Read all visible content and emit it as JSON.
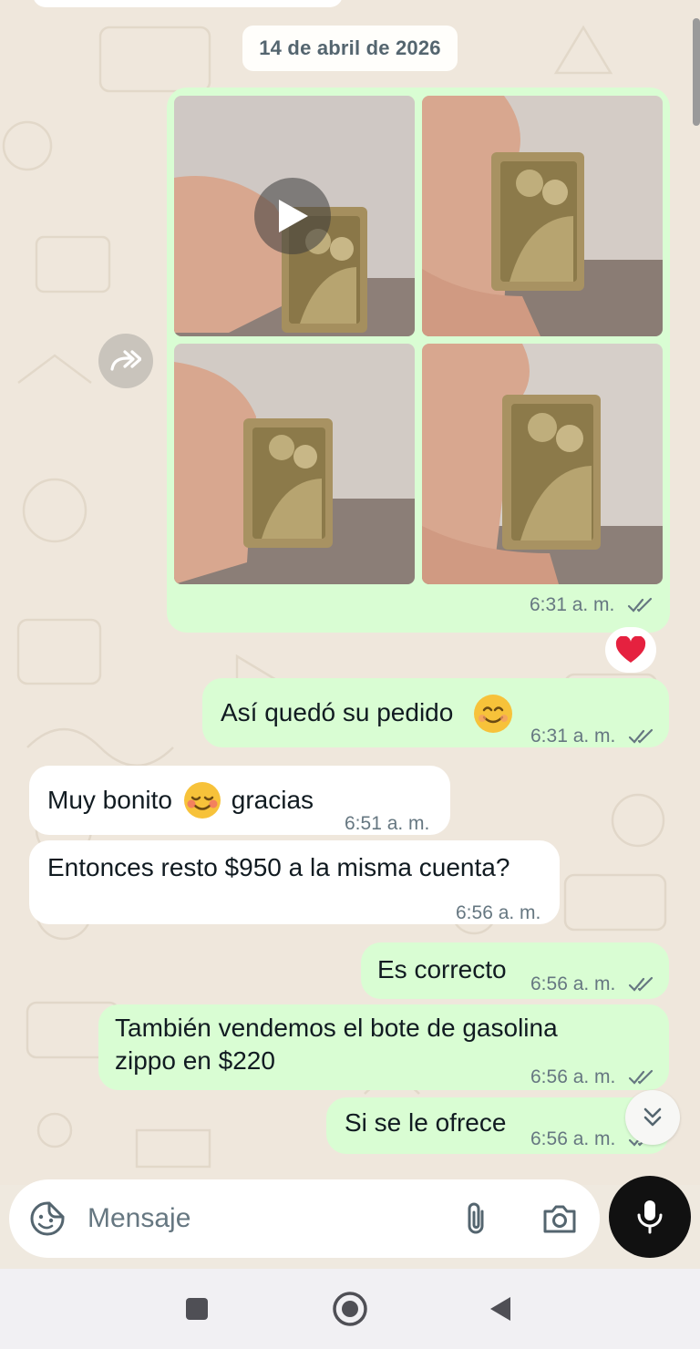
{
  "colors": {
    "wallpaper": "#efe7dc",
    "outgoing_bubble": "#d9fdd3",
    "incoming_bubble": "#ffffff",
    "timestamp": "#667781",
    "tick": "#667781",
    "mic_button": "#111111",
    "heart": "#e5213f"
  },
  "chat": {
    "date_divider": "14 de abril de 2026",
    "media_message": {
      "time": "6:31 a. m.",
      "status": "read",
      "items": [
        "video",
        "photo",
        "photo",
        "photo"
      ],
      "reaction": "heart-emoji"
    },
    "messages": [
      {
        "direction": "out",
        "text": "Así quedó su pedido",
        "emoji": "smiling-face-emoji",
        "time": "6:31 a. m.",
        "status": "read"
      },
      {
        "direction": "in",
        "text_before": "Muy bonito",
        "emoji": "blushing-face-emoji",
        "text_after": " gracias",
        "time": "6:51 a. m."
      },
      {
        "direction": "in",
        "text": "Entonces resto $950 a la misma cuenta?",
        "time": "6:56 a. m."
      },
      {
        "direction": "out",
        "text": "Es correcto",
        "time": "6:56 a. m.",
        "status": "read"
      },
      {
        "direction": "out",
        "text_line1": "También vendemos el bote de gasolina",
        "text_line2": "zippo en $220",
        "time": "6:56 a. m.",
        "status": "read"
      },
      {
        "direction": "out",
        "text": "Si se le ofrece",
        "time": "6:56 a. m.",
        "status": "read"
      }
    ]
  },
  "composer": {
    "placeholder": "Mensaje",
    "icons": [
      "sticker-icon",
      "attach-icon",
      "camera-icon",
      "mic-icon"
    ]
  },
  "navbar": {
    "icons": [
      "recents-icon",
      "home-icon",
      "back-icon"
    ]
  }
}
